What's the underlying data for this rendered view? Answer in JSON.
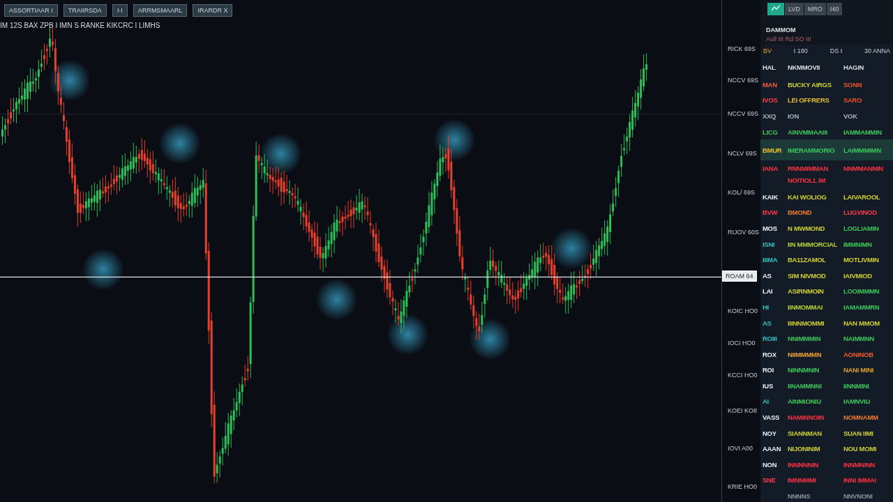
{
  "toolbar": [
    {
      "label": "ASSORTIAAR I"
    },
    {
      "label": "TRAIIRSDA"
    },
    {
      "label": "I·I"
    },
    {
      "label": "ARRMSMAARL"
    },
    {
      "label": "IRARDR X"
    }
  ],
  "chart_title": "IM 12S BAX ZPB I IMN S RANKE KIKCRC I LIMHS",
  "price_axis": [
    {
      "label": "RICK 69S",
      "current": false
    },
    {
      "label": "NCCV 69S",
      "current": false
    },
    {
      "label": "NCCV 69S",
      "current": false
    },
    {
      "label": "NCLV 69S",
      "current": false
    },
    {
      "label": "KOL/ 69S",
      "current": false
    },
    {
      "label": "RIJOV 60S",
      "current": false
    },
    {
      "label": "ROAM 64",
      "current": true
    },
    {
      "label": "KOIC HO0",
      "current": false
    },
    {
      "label": "IOCI HO0",
      "current": false
    },
    {
      "label": "KCCI HO0",
      "current": false
    },
    {
      "label": "KOEI KO8",
      "current": false
    },
    {
      "label": "IOVI A00",
      "current": false
    },
    {
      "label": "KRIE HO0",
      "current": false
    }
  ],
  "panel": {
    "tabs": [
      {
        "kind": "icon",
        "selected": true
      },
      {
        "kind": "text",
        "label": "LVD",
        "selected": false
      },
      {
        "kind": "text",
        "label": "MRO",
        "selected": false
      },
      {
        "kind": "text",
        "label": "I40",
        "selected": false
      }
    ],
    "title": "DAMMOM",
    "subtitle": "Aull III Rd SO III",
    "summary": [
      "BV",
      "I 180",
      "DS I",
      "30 ANNA"
    ],
    "columns": [
      "HAL",
      "NKMMOVII",
      "HAGIN"
    ],
    "rows": [
      {
        "kind": "item",
        "highlighted": false,
        "cells": [
          {
            "text": "MAN",
            "color": "#f0603a"
          },
          {
            "text": "BUCKY AIRGS",
            "color": "#c8d23a"
          },
          {
            "text": "SONN",
            "color": "#f0502a"
          }
        ]
      },
      {
        "kind": "item",
        "highlighted": false,
        "cells": [
          {
            "text": "IVOS",
            "color": "#ff3a4a"
          },
          {
            "text": "LEI OFFRERS",
            "color": "#e0c030"
          },
          {
            "text": "SARO",
            "color": "#f0502a"
          }
        ]
      },
      {
        "kind": "item",
        "highlighted": false,
        "cells": [
          {
            "text": "XXQ",
            "color": "#a8b0b8"
          },
          {
            "text": "ION",
            "color": "#a8b0b8"
          },
          {
            "text": "VOK",
            "color": "#a8b0b8"
          }
        ]
      },
      {
        "kind": "item",
        "highlighted": false,
        "cells": [
          {
            "text": "LICG",
            "color": "#3ac85a"
          },
          {
            "text": "AINVMMAAIII",
            "color": "#3ac85a"
          },
          {
            "text": "IAMMAMMIN",
            "color": "#3ac85a"
          }
        ]
      },
      {
        "kind": "item",
        "highlighted": true,
        "cells": [
          {
            "text": "BMUR",
            "color": "#e8c030"
          },
          {
            "text": "IMERAMMORIO",
            "color": "#3ac85a"
          },
          {
            "text": "LAIMMMIMN",
            "color": "#3ac85a"
          }
        ]
      },
      {
        "kind": "item",
        "highlighted": false,
        "cells": [
          {
            "text": "IANA",
            "color": "#ff3040"
          },
          {
            "text": "RNNMIMMAN",
            "color": "#ff3040"
          },
          {
            "text": "NNMMANNIN",
            "color": "#ff3040"
          }
        ]
      },
      {
        "kind": "continuation",
        "highlighted": false,
        "cells": [
          {
            "text": ""
          },
          {
            "text": "NOITIOLL IM",
            "color": "#ff3040"
          }
        ]
      },
      {
        "kind": "item",
        "highlighted": false,
        "cells": [
          {
            "text": "KAIK",
            "color": "#e8eef4"
          },
          {
            "text": "KAI WOLIOG",
            "color": "#d0d030"
          },
          {
            "text": "LAIVAROOL",
            "color": "#d0d030"
          }
        ]
      },
      {
        "kind": "item",
        "highlighted": false,
        "cells": [
          {
            "text": "BVW",
            "color": "#ff3a4a"
          },
          {
            "text": "BMOND",
            "color": "#f07a2a"
          },
          {
            "text": "LUGVINOD",
            "color": "#ff3a4a"
          }
        ]
      },
      {
        "kind": "item",
        "highlighted": false,
        "cells": [
          {
            "text": "MOS",
            "color": "#e8eef4"
          },
          {
            "text": "N MWMOND",
            "color": "#d0d030"
          },
          {
            "text": "LOGLIAMIN",
            "color": "#3ac85a"
          }
        ]
      },
      {
        "kind": "item",
        "highlighted": false,
        "cells": [
          {
            "text": "ISNI",
            "color": "#30c0c0"
          },
          {
            "text": "IIN MMMORCIAL",
            "color": "#b8d030"
          },
          {
            "text": "IMMNIMN",
            "color": "#3ac85a"
          }
        ]
      },
      {
        "kind": "item",
        "highlighted": false,
        "cells": [
          {
            "text": "IIIMA",
            "color": "#30c0c0"
          },
          {
            "text": "BA11ZAMOL",
            "color": "#d0d030"
          },
          {
            "text": "MOTLIVMIN",
            "color": "#d0d030"
          }
        ]
      },
      {
        "kind": "item",
        "highlighted": false,
        "cells": [
          {
            "text": "AS",
            "color": "#e8eef4"
          },
          {
            "text": "SIM NIVMOD",
            "color": "#d0d030"
          },
          {
            "text": "IAIVMIOD",
            "color": "#d0d030"
          }
        ]
      },
      {
        "kind": "item",
        "highlighted": false,
        "cells": [
          {
            "text": "LAI",
            "color": "#e8eef4"
          },
          {
            "text": "ASIRNMOIN",
            "color": "#d0d030"
          },
          {
            "text": "LOOIMMMN",
            "color": "#3ac85a"
          }
        ]
      },
      {
        "kind": "item",
        "highlighted": false,
        "cells": [
          {
            "text": "HI",
            "color": "#30c0c0"
          },
          {
            "text": "IINMOMMAI",
            "color": "#b8d030"
          },
          {
            "text": "IAMAMMRN",
            "color": "#3ac85a"
          }
        ]
      },
      {
        "kind": "item",
        "highlighted": false,
        "cells": [
          {
            "text": "AS",
            "color": "#30c0c0"
          },
          {
            "text": "IIINNMOMMI",
            "color": "#d0d030"
          },
          {
            "text": "NAN MMOM",
            "color": "#d0d030"
          }
        ]
      },
      {
        "kind": "item",
        "highlighted": false,
        "cells": [
          {
            "text": "ROIII",
            "color": "#30c0c0"
          },
          {
            "text": "NNIMMMIN",
            "color": "#3ac85a"
          },
          {
            "text": "NAIMMNN",
            "color": "#3ac85a"
          }
        ]
      },
      {
        "kind": "item",
        "highlighted": false,
        "cells": [
          {
            "text": "ROX",
            "color": "#e8eef4"
          },
          {
            "text": "NIIMMMMN",
            "color": "#f0a030"
          },
          {
            "text": "AONINOB",
            "color": "#f05a2a"
          }
        ]
      },
      {
        "kind": "item",
        "highlighted": false,
        "cells": [
          {
            "text": "ROI",
            "color": "#e8eef4"
          },
          {
            "text": "NINNMNIN",
            "color": "#3ac85a"
          },
          {
            "text": "NANI MINI",
            "color": "#e0a030"
          }
        ]
      },
      {
        "kind": "item",
        "highlighted": false,
        "cells": [
          {
            "text": "IUS",
            "color": "#e8eef4"
          },
          {
            "text": "IINAMMNNI",
            "color": "#3ac85a"
          },
          {
            "text": "IINNMINI",
            "color": "#3ac85a"
          }
        ]
      },
      {
        "kind": "item",
        "highlighted": false,
        "cells": [
          {
            "text": "AI",
            "color": "#30c0c0"
          },
          {
            "text": "AINMIONIU",
            "color": "#3ac85a"
          },
          {
            "text": "IAMNVIU",
            "color": "#3ac85a"
          }
        ]
      },
      {
        "kind": "item",
        "highlighted": false,
        "cells": [
          {
            "text": "VASS",
            "color": "#e8eef4"
          },
          {
            "text": "NAMINNOIN",
            "color": "#ff3040"
          },
          {
            "text": "NOMNAMM",
            "color": "#f07a2a"
          }
        ]
      },
      {
        "kind": "item",
        "highlighted": false,
        "cells": [
          {
            "text": "NOY",
            "color": "#e8eef4"
          },
          {
            "text": "SIANNMAN",
            "color": "#d0d030"
          },
          {
            "text": "SUAN IIMI",
            "color": "#d0d030"
          }
        ]
      },
      {
        "kind": "item",
        "highlighted": false,
        "cells": [
          {
            "text": "AAAN",
            "color": "#e8eef4"
          },
          {
            "text": "NIJONINIM",
            "color": "#d0d030"
          },
          {
            "text": "NOU MOMI",
            "color": "#d0d030"
          }
        ]
      },
      {
        "kind": "item",
        "highlighted": false,
        "cells": [
          {
            "text": "NON",
            "color": "#e8eef4"
          },
          {
            "text": "INNNNNIN",
            "color": "#ff3040"
          },
          {
            "text": "INNMNINN",
            "color": "#ff3040"
          }
        ]
      },
      {
        "kind": "item",
        "highlighted": false,
        "cells": [
          {
            "text": "SNE",
            "color": "#ff3a4a"
          },
          {
            "text": "IMNNMMI",
            "color": "#ff3040"
          },
          {
            "text": "INNI IMMAI",
            "color": "#ff3040"
          }
        ]
      }
    ],
    "footer": [
      "NNNNS",
      "NNVNONI"
    ]
  }
}
